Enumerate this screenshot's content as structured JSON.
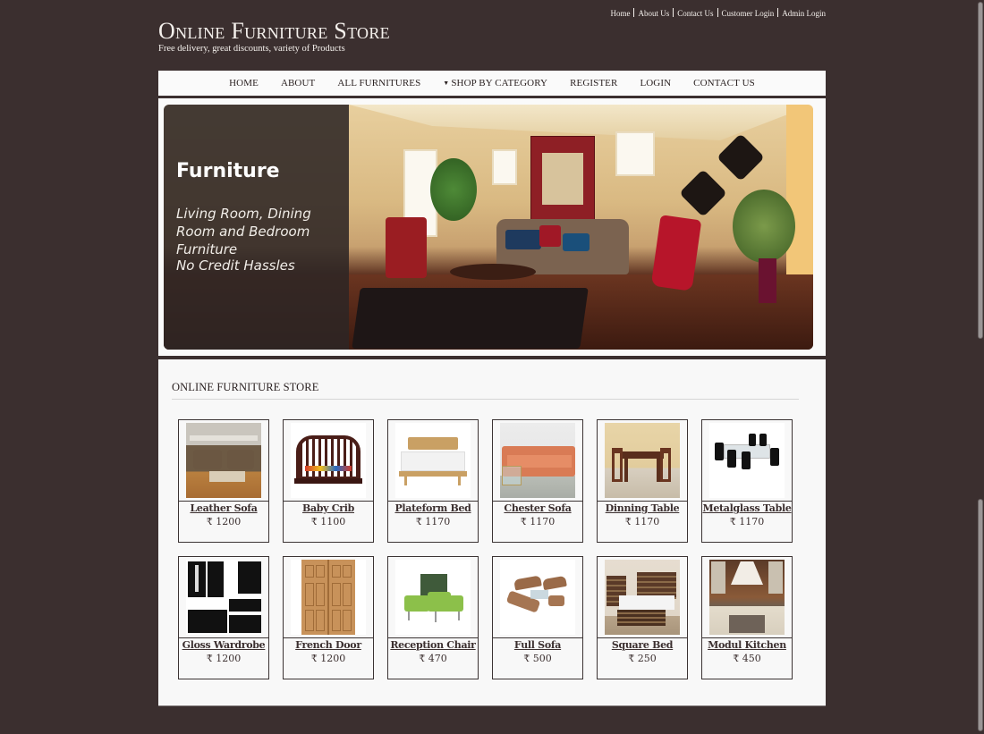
{
  "header": {
    "site_title": "Online Furniture Store",
    "tagline": "Free delivery, great discounts, variety of Products",
    "top_links": [
      "Home",
      "About Us",
      "Contact Us",
      "Customer Login",
      "Admin Login"
    ]
  },
  "nav": {
    "items": [
      {
        "label": "HOME"
      },
      {
        "label": "ABOUT"
      },
      {
        "label": "ALL FURNITURES"
      },
      {
        "label": "SHOP BY CATEGORY",
        "icon": "caret-down-icon"
      },
      {
        "label": "REGISTER"
      },
      {
        "label": "LOGIN"
      },
      {
        "label": "CONTACT US"
      }
    ]
  },
  "banner": {
    "title": "Furniture",
    "subtitle": "Living Room, Dining Room and Bedroom Furniture",
    "subtitle2": "No Credit Hassles"
  },
  "section": {
    "title": "ONLINE FURNITURE STORE"
  },
  "currency_symbol": "₹",
  "products": [
    {
      "name": "Leather Sofa",
      "price": "₹ 1200"
    },
    {
      "name": "Baby Crib",
      "price": "₹ 1100"
    },
    {
      "name": "Plateform Bed",
      "price": "₹ 1170"
    },
    {
      "name": "Chester Sofa",
      "price": "₹ 1170"
    },
    {
      "name": "Dinning Table",
      "price": "₹ 1170"
    },
    {
      "name": "Metalglass Table",
      "price": "₹ 1170"
    },
    {
      "name": "Gloss Wardrobe",
      "price": "₹ 1200"
    },
    {
      "name": "French Door",
      "price": "₹ 1200"
    },
    {
      "name": "Reception Chair",
      "price": "₹ 470"
    },
    {
      "name": "Full Sofa",
      "price": "₹ 500"
    },
    {
      "name": "Square Bed",
      "price": "₹ 250"
    },
    {
      "name": "Modul Kitchen",
      "price": "₹ 450"
    }
  ],
  "colors": {
    "page_bg": "#3b2f2f",
    "panel_bg": "#f8f8f8",
    "text_dark": "#3b2f2f",
    "header_text": "#f4f0ec"
  }
}
